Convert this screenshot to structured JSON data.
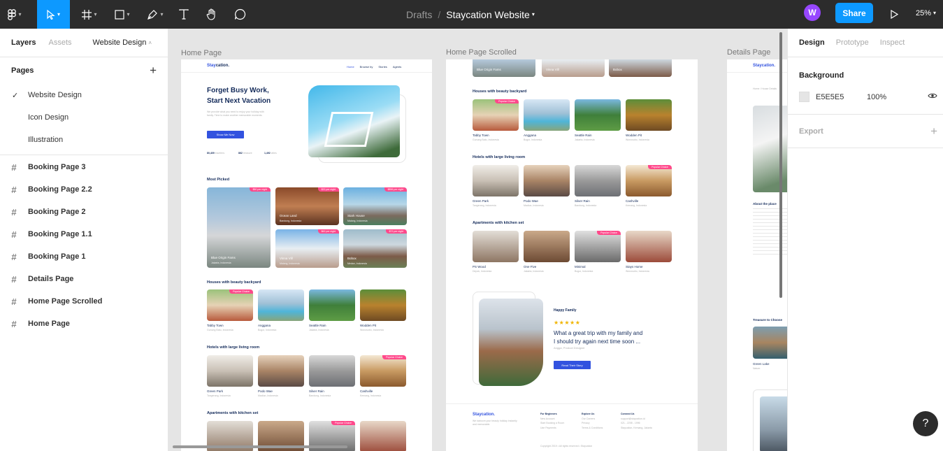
{
  "toolbar": {
    "tools": [
      "figma-menu-icon",
      "move-tool-icon",
      "frame-tool-icon",
      "shape-tool-icon",
      "pen-tool-icon",
      "text-tool-icon",
      "hand-tool-icon",
      "comment-tool-icon"
    ],
    "breadcrumb_parent": "Drafts",
    "breadcrumb_sep": "/",
    "file_name": "Staycation Website",
    "avatar_initial": "W",
    "share_label": "Share",
    "zoom": "25%"
  },
  "left_panel": {
    "tabs": [
      "Layers",
      "Assets"
    ],
    "current_page_select": "Website Design",
    "pages_title": "Pages",
    "pages": [
      {
        "label": "Website Design",
        "selected": true
      },
      {
        "label": "Icon Design",
        "selected": false
      },
      {
        "label": "Illustration",
        "selected": false
      }
    ],
    "layers": [
      "Booking Page 3",
      "Booking Page 2.2",
      "Booking Page 2",
      "Booking Page 1.1",
      "Booking Page 1",
      "Details Page",
      "Home Page Scrolled",
      "Home Page"
    ]
  },
  "canvas": {
    "frame_labels": [
      "Home Page",
      "Home Page Scrolled",
      "Details Page"
    ],
    "home": {
      "logo_a": "Stay",
      "logo_b": "cation.",
      "nav": [
        "Home",
        "Browse by",
        "Stories",
        "Agents"
      ],
      "hero_title_1": "Forget Busy Work,",
      "hero_title_2": "Start Next Vacation",
      "hero_sub": "We provide what you need to enjoy your holiday with family. Time to make another memorable moments.",
      "hero_button": "Show Me Now",
      "stats": [
        {
          "num": "80,409",
          "label": "travelers"
        },
        {
          "num": "862",
          "label": "treasure"
        },
        {
          "num": "1,492",
          "label": "cities"
        }
      ],
      "most_picked": "Most Picked",
      "most_picked_cards": [
        {
          "name": "Blue Origin Fams",
          "loc": "Jakarta, Indonesia",
          "price": "$50 per night"
        },
        {
          "name": "Ocean Land",
          "loc": "Bandung, Indonesia",
          "price": "$22 per night"
        },
        {
          "name": "Stark House",
          "loc": "Malang, Indonesia",
          "price": "$856 per night"
        },
        {
          "name": "Vinna Vill",
          "loc": "Malang, Indonesia",
          "price": "$62 per night"
        },
        {
          "name": "Bobox",
          "loc": "Medan, Indonesia",
          "price": "$72 per night"
        }
      ],
      "houses_title": "Houses with beauty backyard",
      "houses": [
        {
          "name": "Tabby Town",
          "loc": "Gunung Batu, Indonesia",
          "badge": "Popular Choice"
        },
        {
          "name": "Anggana",
          "loc": "Bogor, Indonesia",
          "badge": ""
        },
        {
          "name": "Seattle Rain",
          "loc": "Jakarta, Indonesia",
          "badge": ""
        },
        {
          "name": "Wodden Pit",
          "loc": "Wonosobo, Indonesia",
          "badge": ""
        }
      ],
      "hotels_title": "Hotels with large living room",
      "hotels": [
        {
          "name": "Green Park",
          "loc": "Tangerang, Indonesia",
          "badge": ""
        },
        {
          "name": "Podo Wae",
          "loc": "Madiun, Indonesia",
          "badge": ""
        },
        {
          "name": "Silver Rain",
          "loc": "Bandung, Indonesia",
          "badge": ""
        },
        {
          "name": "Cashville",
          "loc": "Kemang, Indonesia",
          "badge": "Popular Choice"
        }
      ],
      "apartments_title": "Apartments with kitchen set"
    },
    "scrolled": {
      "houses_title": "Houses with beauty backyard",
      "hotels_title": "Hotels with large living room",
      "apartments_title": "Apartments with kitchen set",
      "apartments": [
        {
          "name": "PS Wood",
          "loc": "Depok, Indonesia",
          "badge": ""
        },
        {
          "name": "One Five",
          "loc": "Jakarta, Indonesia",
          "badge": ""
        },
        {
          "name": "Minimal",
          "loc": "Bogor, Indonesia",
          "badge": "Popular Choice"
        },
        {
          "name": "Stays Home",
          "loc": "Wonosobo, Indonesia",
          "badge": ""
        }
      ],
      "testimonial_title": "Happy Family",
      "stars": "★★★★★",
      "quote_1": "What a great trip with my family and",
      "quote_2": "I should try again next time soon ...",
      "author": "Angga, Product Designer",
      "story_button": "Read Their Story",
      "footer_logo": "Staycation.",
      "footer_tagline": "We kaboom your beauty holiday instantly and memorable.",
      "footer_cols": [
        {
          "title": "For Beginners",
          "items": [
            "New Account",
            "Start Booking a Room",
            "Use Payments"
          ]
        },
        {
          "title": "Explore Us",
          "items": [
            "Our Careers",
            "Privacy",
            "Terms & Conditions"
          ]
        },
        {
          "title": "Connect Us",
          "items": [
            "support@staycation.id",
            "021 - 2208 - 1996",
            "Staycation, Kemang, Jakarta"
          ]
        }
      ],
      "copyright": "Copyright 2019 • All rights reserved • Staycation"
    },
    "details": {
      "logo": "Staycation.",
      "breadcrumb": "Home / House Details",
      "about": "About the place",
      "treasure": "Treasure to Choose",
      "card_name": "Green Lake",
      "card_loc": "Nature"
    }
  },
  "right_panel": {
    "tabs": [
      "Design",
      "Prototype",
      "Inspect"
    ],
    "background_title": "Background",
    "bg_hex": "E5E5E5",
    "bg_opacity": "100%",
    "export_title": "Export"
  },
  "help_label": "?"
}
